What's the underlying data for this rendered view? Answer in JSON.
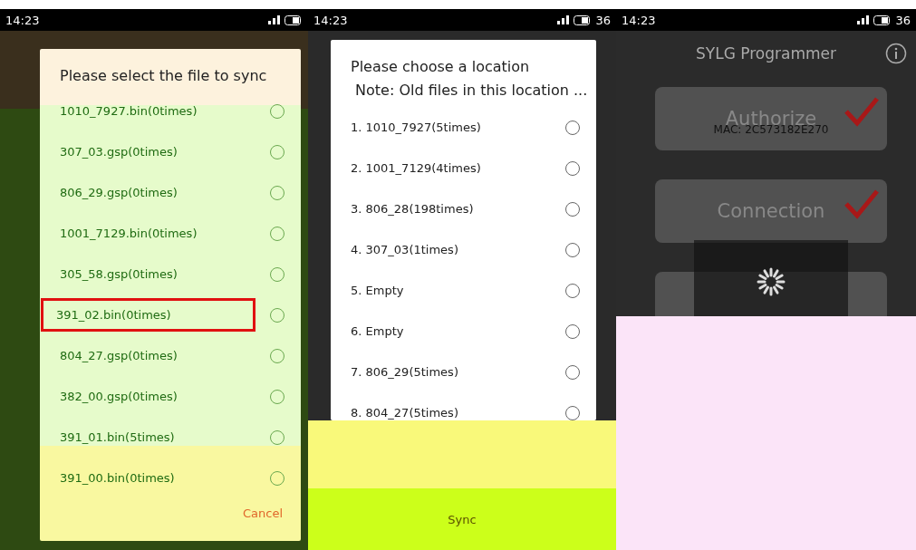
{
  "screens": [
    {
      "status_bar": {
        "time": "14:23"
      },
      "dialog": {
        "title": "Please select the file to sync",
        "items": [
          {
            "label": "1010_7927.bin(0times)",
            "selected": false,
            "highlighted": false
          },
          {
            "label": "307_03.gsp(0times)",
            "selected": false,
            "highlighted": false
          },
          {
            "label": "806_29.gsp(0times)",
            "selected": false,
            "highlighted": false
          },
          {
            "label": "1001_7129.bin(0times)",
            "selected": false,
            "highlighted": false
          },
          {
            "label": "305_58.gsp(0times)",
            "selected": false,
            "highlighted": false
          },
          {
            "label": "391_02.bin(0times)",
            "selected": false,
            "highlighted": true
          },
          {
            "label": "804_27.gsp(0times)",
            "selected": false,
            "highlighted": false
          },
          {
            "label": "382_00.gsp(0times)",
            "selected": false,
            "highlighted": false
          },
          {
            "label": "391_01.bin(5times)",
            "selected": false,
            "highlighted": false
          },
          {
            "label": "391_00.bin(0times)",
            "selected": false,
            "highlighted": false
          }
        ],
        "buttons": [
          "Cancel"
        ]
      }
    },
    {
      "status_bar": {
        "time": "14:23",
        "battery": "36"
      },
      "dialog": {
        "title": "Please choose a location",
        "subtitle": " Note: Old files in this location ...",
        "items": [
          {
            "label": "1. 1010_7927(5times)",
            "selected": false,
            "highlighted": false
          },
          {
            "label": "2. 1001_7129(4times)",
            "selected": false,
            "highlighted": false
          },
          {
            "label": "3. 806_28(198times)",
            "selected": false,
            "highlighted": false
          },
          {
            "label": "4. 307_03(1times)",
            "selected": false,
            "highlighted": false
          },
          {
            "label": "5. Empty",
            "selected": false,
            "highlighted": false
          },
          {
            "label": "6. Empty",
            "selected": false,
            "highlighted": false
          },
          {
            "label": "7. 806_29(5times)",
            "selected": false,
            "highlighted": false
          },
          {
            "label": "8. 804_27(5times)",
            "selected": false,
            "highlighted": false
          }
        ],
        "buttons": [
          "Sync"
        ]
      }
    },
    {
      "status_bar": {
        "time": "14:23",
        "battery": "36"
      },
      "app": {
        "title": "SYLG Programmer",
        "cards": [
          {
            "label": "Authorize",
            "done": true,
            "detail": "MAC:  2C573182E270"
          },
          {
            "label": "Connection",
            "done": true
          }
        ],
        "loading": true
      }
    }
  ]
}
